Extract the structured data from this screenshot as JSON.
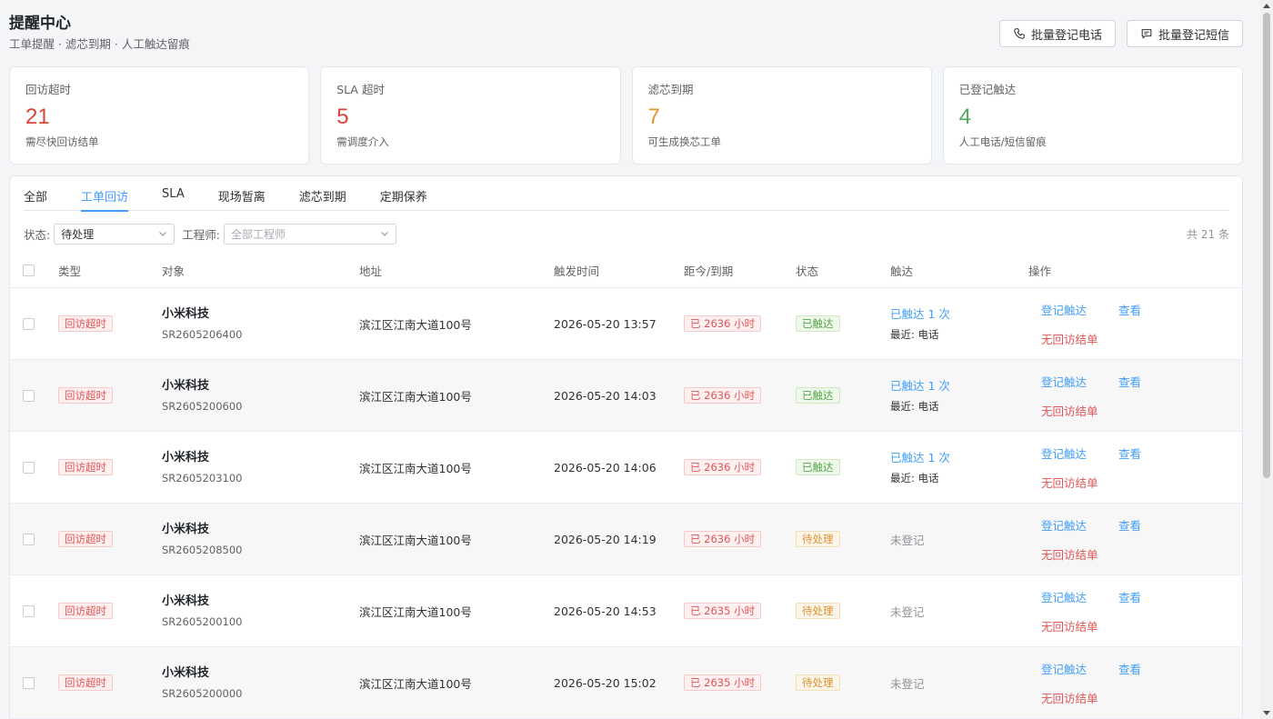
{
  "header": {
    "title": "提醒中心",
    "subtitle": "工单提醒 · 滤芯到期 · 人工触达留痕",
    "actions": {
      "batch_call": "批量登记电话",
      "batch_sms": "批量登记短信"
    }
  },
  "cards": [
    {
      "label": "回访超时",
      "value": "21",
      "desc": "需尽快回访结单",
      "color": "#d9433b"
    },
    {
      "label": "SLA 超时",
      "value": "5",
      "desc": "需调度介入",
      "color": "#d9433b"
    },
    {
      "label": "滤芯到期",
      "value": "7",
      "desc": "可生成换芯工单",
      "color": "#e0962b"
    },
    {
      "label": "已登记触达",
      "value": "4",
      "desc": "人工电话/短信留痕",
      "color": "#4fa85c"
    }
  ],
  "tabs": [
    {
      "label": "全部",
      "active": false
    },
    {
      "label": "工单回访",
      "active": true
    },
    {
      "label": "SLA",
      "active": false
    },
    {
      "label": "现场暂离",
      "active": false
    },
    {
      "label": "滤芯到期",
      "active": false
    },
    {
      "label": "定期保养",
      "active": false
    }
  ],
  "filters": {
    "status_label": "状态:",
    "status_value": "待处理",
    "engineer_label": "工程师:",
    "engineer_placeholder": "全部工程师",
    "total": "共 21 条"
  },
  "table": {
    "headers": {
      "type": "类型",
      "object": "对象",
      "address": "地址",
      "trigger_time": "触发时间",
      "due": "距今/到期",
      "status": "状态",
      "touch": "触达",
      "action": "操作"
    },
    "rows": [
      {
        "type": "回访超时",
        "name": "小米科技",
        "id": "SR2605206400",
        "address": "滨江区江南大道100号",
        "time": "2026-05-20 13:57",
        "due": "已 2636 小时",
        "status": "已触达",
        "touch": "已触达 1 次",
        "touch_last": "最近: 电话",
        "op_register": "登记触达",
        "op_view": "查看",
        "op_warn": "无回访结单"
      },
      {
        "type": "回访超时",
        "name": "小米科技",
        "id": "SR2605200600",
        "address": "滨江区江南大道100号",
        "time": "2026-05-20 14:03",
        "due": "已 2636 小时",
        "status": "已触达",
        "touch": "已触达 1 次",
        "touch_last": "最近: 电话",
        "op_register": "登记触达",
        "op_view": "查看",
        "op_warn": "无回访结单"
      },
      {
        "type": "回访超时",
        "name": "小米科技",
        "id": "SR2605203100",
        "address": "滨江区江南大道100号",
        "time": "2026-05-20 14:06",
        "due": "已 2636 小时",
        "status": "已触达",
        "touch": "已触达 1 次",
        "touch_last": "最近: 电话",
        "op_register": "登记触达",
        "op_view": "查看",
        "op_warn": "无回访结单"
      },
      {
        "type": "回访超时",
        "name": "小米科技",
        "id": "SR2605208500",
        "address": "滨江区江南大道100号",
        "time": "2026-05-20 14:19",
        "due": "已 2636 小时",
        "status": "待处理",
        "touch": "未登记",
        "touch_last": "",
        "op_register": "登记触达",
        "op_view": "查看",
        "op_warn": "无回访结单"
      },
      {
        "type": "回访超时",
        "name": "小米科技",
        "id": "SR2605200100",
        "address": "滨江区江南大道100号",
        "time": "2026-05-20 14:53",
        "due": "已 2635 小时",
        "status": "待处理",
        "touch": "未登记",
        "touch_last": "",
        "op_register": "登记触达",
        "op_view": "查看",
        "op_warn": "无回访结单"
      },
      {
        "type": "回访超时",
        "name": "小米科技",
        "id": "SR2605200000",
        "address": "滨江区江南大道100号",
        "time": "2026-05-20 15:02",
        "due": "已 2635 小时",
        "status": "待处理",
        "touch": "未登记",
        "touch_last": "",
        "op_register": "登记触达",
        "op_view": "查看",
        "op_warn": "无回访结单"
      }
    ]
  }
}
